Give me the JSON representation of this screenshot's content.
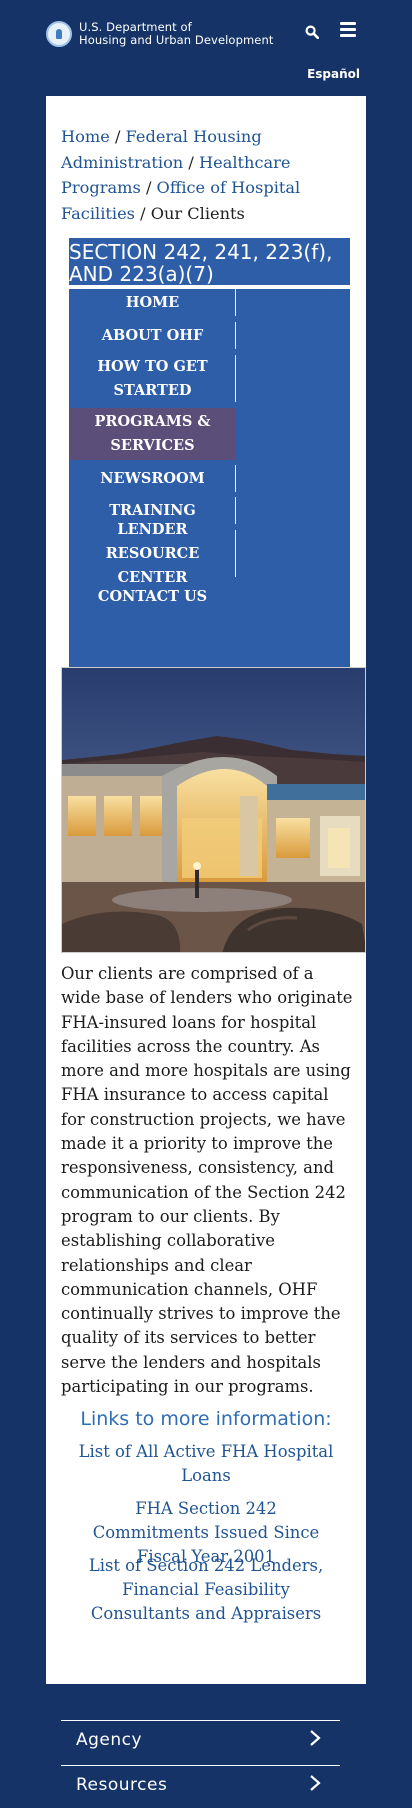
{
  "header": {
    "agency_line1": "U.S. Department of",
    "agency_line2": "Housing and Urban Development",
    "language_link": "Español"
  },
  "breadcrumb": {
    "home": "Home",
    "sep": " / ",
    "fha": "Federal Housing Administration",
    "healthcare": "Healthcare Programs",
    "ohf": "Office of Hospital Facilities",
    "current": "Our Clients"
  },
  "section_title": "SECTION 242, 241, 223(f), AND 223(a)(7)",
  "nav": {
    "items": [
      {
        "label": "HOME"
      },
      {
        "label": "ABOUT OHF"
      },
      {
        "label": "HOW TO GET STARTED"
      },
      {
        "label": "PROGRAMS & SERVICES"
      },
      {
        "label": "NEWSROOM"
      },
      {
        "label": "TRAINING"
      },
      {
        "label": "LENDER RESOURCE CENTER"
      },
      {
        "label": "CONTACT US"
      }
    ]
  },
  "body": {
    "paragraph": "Our clients are comprised of a wide base of lenders who originate FHA-insured loans for hospital facilities across the country. As more and more hospitals are using FHA insurance to access capital for construction projects, we have made it a priority to improve the responsiveness, consistency, and communication of the Section 242 program to our clients. By establishing collaborative relationships and clear communication channels, OHF continually strives to improve the quality of its services to better serve the lenders and hospitals participating in our programs."
  },
  "links": {
    "heading": "Links to more information:",
    "items": [
      {
        "label": "List of All Active FHA Hospital Loans"
      },
      {
        "label": "FHA Section 242 Commitments Issued Since Fiscal Year 2001"
      },
      {
        "label": "List of Section 242 Lenders, Financial Feasibility Consultants and Appraisers"
      }
    ]
  },
  "footer": {
    "items": [
      {
        "label": "Agency"
      },
      {
        "label": "Resources"
      }
    ]
  },
  "colors": {
    "navy": "#153366",
    "nav_blue": "#2f5ea9",
    "active_purple": "#5b4f7a",
    "link_blue": "#205493"
  },
  "icons": [
    "hud-seal-icon",
    "search-icon",
    "hamburger-menu-icon",
    "chevron-right-icon"
  ]
}
